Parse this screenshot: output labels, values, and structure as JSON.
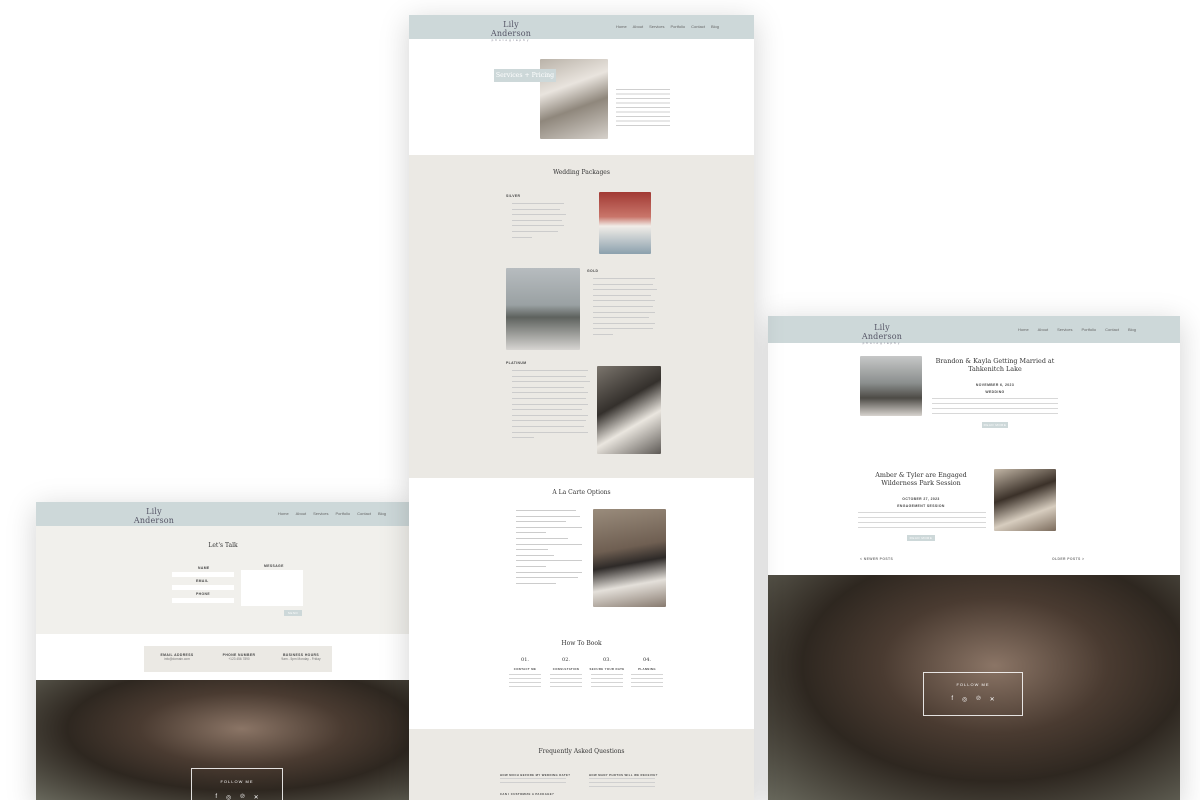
{
  "brand": {
    "name": "Lily Anderson",
    "tagline": "Photography"
  },
  "nav": [
    "Home",
    "About",
    "Services",
    "Portfolio",
    "Contact",
    "Blog"
  ],
  "center": {
    "hero_title": "Services + Pricing",
    "wedding_packages": {
      "title": "Wedding Packages",
      "silver": {
        "label": "SILVER"
      },
      "gold": {
        "label": "GOLD"
      },
      "platinum": {
        "label": "PLATINUM"
      }
    },
    "a_la_carte": {
      "title": "A La Carte Options"
    },
    "how_to_book": {
      "title": "How To Book",
      "steps": [
        {
          "num": "01.",
          "label": "CONTACT ME"
        },
        {
          "num": "02.",
          "label": "CONSULTATION"
        },
        {
          "num": "03.",
          "label": "SECURE YOUR DATE"
        },
        {
          "num": "04.",
          "label": "PLANNING"
        }
      ]
    },
    "faq": {
      "title": "Frequently Asked Questions",
      "q1": "HOW MUCH BEFORE MY WEDDING DATE?",
      "q2": "HOW MANY PHOTOS WILL WE RECEIVE?",
      "q3": "CAN I CUSTOMIZE A PACKAGE?"
    }
  },
  "left": {
    "contact_title": "Let's Talk",
    "labels": {
      "name": "NAME",
      "email": "EMAIL",
      "phone": "PHONE",
      "message": "MESSAGE"
    },
    "send": "SEND",
    "info": [
      {
        "label": "EMAIL ADDRESS",
        "value": "info@domain.com"
      },
      {
        "label": "PHONE NUMBER",
        "value": "+123 456 7890"
      },
      {
        "label": "BUSINESS HOURS",
        "value": "9am - 5pm Monday - Friday"
      }
    ],
    "follow": "FOLLOW ME"
  },
  "right": {
    "posts": [
      {
        "title": "Brandon & Kayla Getting Married at Tahkenitch Lake",
        "date": "NOVEMBER 6, 2023",
        "category": "WEDDING",
        "button": "READ MORE"
      },
      {
        "title": "Amber & Tyler are Engaged Wilderness Park Session",
        "date": "OCTOBER 27, 2023",
        "category": "ENGAGEMENT SESSION",
        "button": "READ MORE"
      }
    ],
    "newer": "< NEWER POSTS",
    "older": "OLDER POSTS >",
    "follow": "FOLLOW ME"
  },
  "social_icons": [
    "facebook-icon",
    "instagram-icon",
    "pinterest-icon",
    "x-icon"
  ],
  "colors": {
    "header": "#cdd8d9",
    "section_bg": "#ebe9e4",
    "contact_bg": "#f1f0ec"
  }
}
